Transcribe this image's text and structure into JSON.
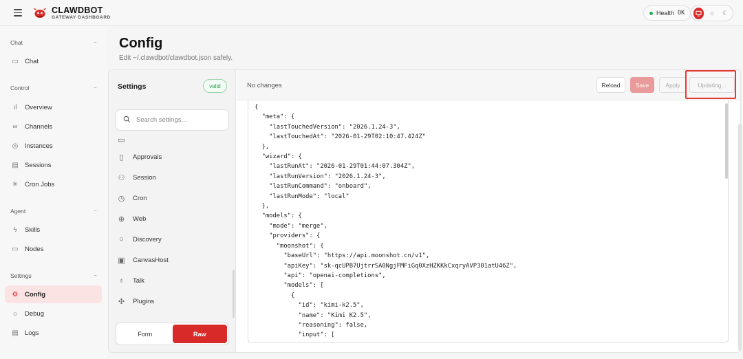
{
  "header": {
    "brand_title": "CLAWDBOT",
    "brand_subtitle": "GATEWAY DASHBOARD",
    "health_label": "Health",
    "health_value": "OK",
    "accent": "#d92a2a"
  },
  "sidebar": {
    "sections": [
      {
        "title": "Chat",
        "items": [
          {
            "label": "Chat",
            "icon": "chat-bubble-icon"
          }
        ]
      },
      {
        "title": "Control",
        "items": [
          {
            "label": "Overview",
            "icon": "bar-chart-icon"
          },
          {
            "label": "Channels",
            "icon": "link-icon"
          },
          {
            "label": "Instances",
            "icon": "broadcast-icon"
          },
          {
            "label": "Sessions",
            "icon": "document-icon"
          },
          {
            "label": "Cron Jobs",
            "icon": "loader-icon"
          }
        ]
      },
      {
        "title": "Agent",
        "items": [
          {
            "label": "Skills",
            "icon": "lightning-icon"
          },
          {
            "label": "Nodes",
            "icon": "monitor-icon"
          }
        ]
      },
      {
        "title": "Settings",
        "items": [
          {
            "label": "Config",
            "icon": "gear-icon",
            "active": true
          },
          {
            "label": "Debug",
            "icon": "bug-icon"
          },
          {
            "label": "Logs",
            "icon": "log-icon"
          }
        ]
      }
    ]
  },
  "page": {
    "title": "Config",
    "subtitle": "Edit ~/.clawdbot/clawdbot.json safely."
  },
  "settings_panel": {
    "title": "Settings",
    "status_badge": "valid",
    "search_placeholder": "Search settings...",
    "categories": [
      {
        "label": "Approvals",
        "icon": "file-icon"
      },
      {
        "label": "Session",
        "icon": "users-icon"
      },
      {
        "label": "Cron",
        "icon": "clock-icon"
      },
      {
        "label": "Web",
        "icon": "globe-icon"
      },
      {
        "label": "Discovery",
        "icon": "search-icon"
      },
      {
        "label": "CanvasHost",
        "icon": "image-icon"
      },
      {
        "label": "Talk",
        "icon": "microphone-icon"
      },
      {
        "label": "Plugins",
        "icon": "puzzle-icon"
      }
    ],
    "mode_form": "Form",
    "mode_raw": "Raw",
    "active_mode": "Raw"
  },
  "editor": {
    "status": "No changes",
    "reload_label": "Reload",
    "save_label": "Save",
    "apply_label": "Apply",
    "updating_label": "Updating...",
    "lines": [
      "{",
      "  \"meta\": {",
      "    \"lastTouchedVersion\": \"2026.1.24-3\",",
      "    \"lastTouchedAt\": \"2026-01-29T02:10:47.424Z\"",
      "  },",
      "  \"wizard\": {",
      "    \"lastRunAt\": \"2026-01-29T01:44:07.304Z\",",
      "    \"lastRunVersion\": \"2026.1.24-3\",",
      "    \"lastRunCommand\": \"onboard\",",
      "    \"lastRunMode\": \"local\"",
      "  },",
      "  \"models\": {",
      "    \"mode\": \"merge\",",
      "    \"providers\": {",
      "      \"moonshot\": {",
      "        \"baseUrl\": \"https://api.moonshot.cn/v1\",",
      "        \"apiKey\": \"sk-qcUPB7UjtrrSA0NgjFMFiGq0XzHZKKkCxqryAVP301atU46Z\",",
      "        \"api\": \"openai-completions\",",
      "        \"models\": [",
      "          {",
      "            \"id\": \"kimi-k2.5\",",
      "            \"name\": \"Kimi K2.5\",",
      "            \"reasoning\": false,",
      "            \"input\": ["
    ]
  }
}
